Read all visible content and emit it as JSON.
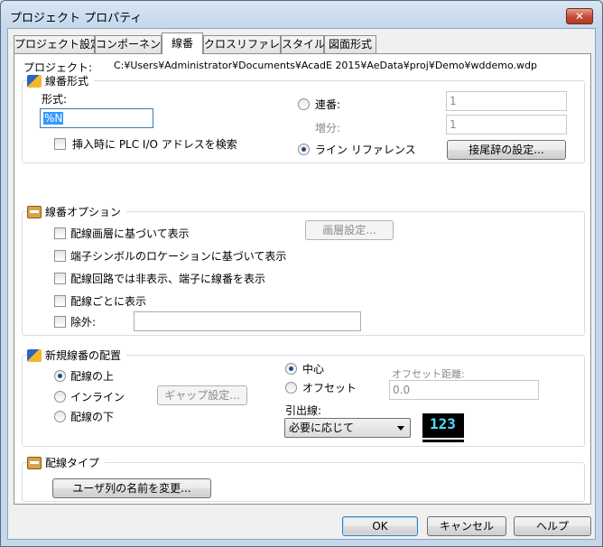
{
  "window": {
    "title": "プロジェクト プロパティ",
    "close_glyph": "✕"
  },
  "tabs": [
    {
      "label": "プロジェクト設定",
      "active": false
    },
    {
      "label": "コンポーネント",
      "active": false
    },
    {
      "label": "線番",
      "active": true
    },
    {
      "label": "クロスリファレンス",
      "active": false
    },
    {
      "label": "スタイル",
      "active": false
    },
    {
      "label": "図面形式",
      "active": false
    }
  ],
  "project": {
    "label": "プロジェクト:",
    "path": "C:¥Users¥Administrator¥Documents¥AcadE 2015¥AeData¥proj¥Demo¥wddemo.wdp"
  },
  "wire_number_format": {
    "title": "線番形式",
    "format_label": "形式:",
    "format_value": "%N",
    "search_plc_label": "挿入時に PLC I/O アドレスを検索",
    "sequential_label": "連番:",
    "sequential_value": "1",
    "increment_label": "増分:",
    "increment_value": "1",
    "line_reference_label": "ライン リファレンス",
    "suffix_button": "接尾辞の設定..."
  },
  "wire_number_options": {
    "title": "線番オプション",
    "items": [
      {
        "label": "配線画層に基づいて表示"
      },
      {
        "label": "端子シンボルのロケーションに基づいて表示"
      },
      {
        "label": "配線回路では非表示、端子に線番を表示"
      },
      {
        "label": "配線ごとに表示"
      },
      {
        "label": "除外:"
      }
    ],
    "layer_button": "画層設定...",
    "exclude_value": ""
  },
  "new_wire_placement": {
    "title": "新規線番の配置",
    "above_label": "配線の上",
    "inline_label": "インライン",
    "below_label": "配線の下",
    "gap_button": "ギャップ設定...",
    "center_label": "中心",
    "offset_label": "オフセット",
    "offset_distance_label": "オフセット距離:",
    "offset_distance_value": "0.0",
    "leader_label": "引出線:",
    "leader_value": "必要に応じて",
    "preview_number": "123"
  },
  "wire_type": {
    "title": "配線タイプ",
    "rename_button": "ユーザ列の名前を変更..."
  },
  "footer": {
    "ok": "OK",
    "cancel": "キャンセル",
    "help": "ヘルプ"
  }
}
